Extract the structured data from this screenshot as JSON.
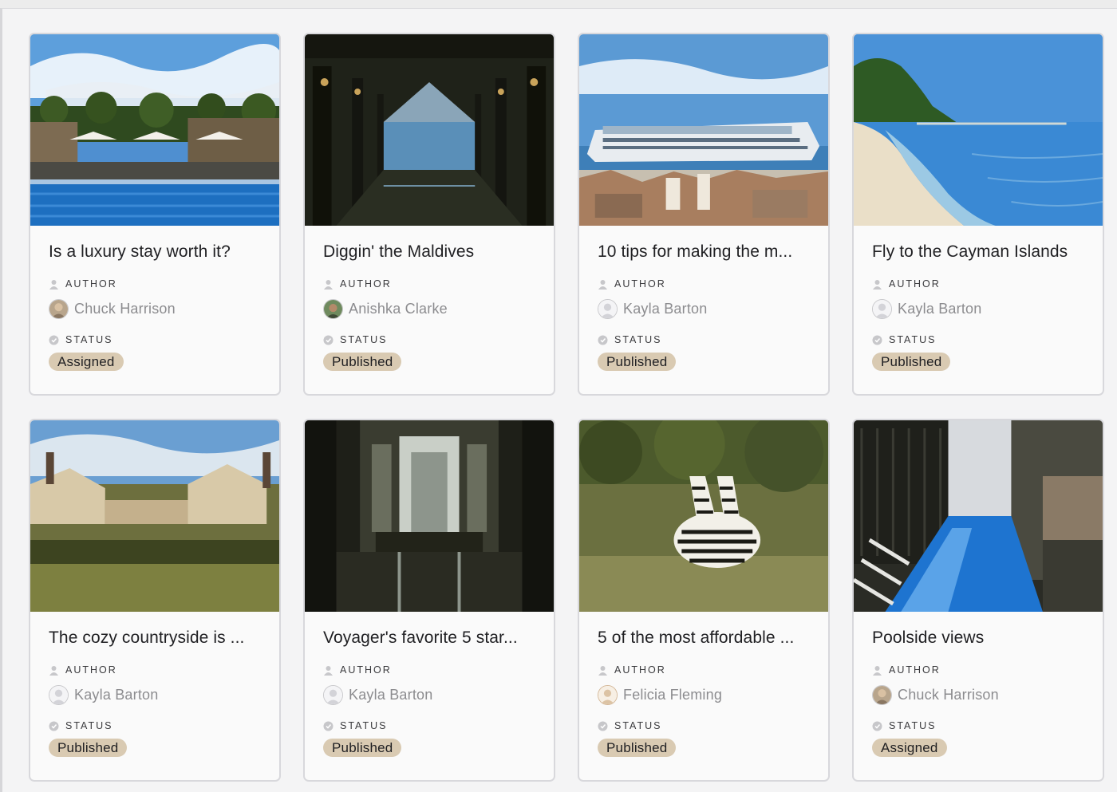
{
  "fields": {
    "author_label": "AUTHOR",
    "status_label": "STATUS"
  },
  "colors": {
    "pill_bg": "#d9cab2",
    "author_text": "#8c8c8f",
    "card_border": "#d8d8dc"
  },
  "cards": [
    {
      "title": "Is a luxury stay worth it?",
      "author": "Chuck Harrison",
      "avatar": "photo-avatar",
      "status": "Assigned",
      "cover": "resort-pool-image"
    },
    {
      "title": "Diggin' the Maldives",
      "author": "Anishka Clarke",
      "avatar": "photo-avatar",
      "status": "Published",
      "cover": "overwater-pier-image"
    },
    {
      "title": "10 tips for making the m...",
      "author": "Kayla Barton",
      "avatar": "default-user-avatar",
      "status": "Published",
      "cover": "cruise-ship-image"
    },
    {
      "title": "Fly to the Cayman Islands",
      "author": "Kayla Barton",
      "avatar": "default-user-avatar",
      "status": "Published",
      "cover": "beach-image"
    },
    {
      "title": "The cozy countryside is ...",
      "author": "Kayla Barton",
      "avatar": "default-user-avatar",
      "status": "Published",
      "cover": "country-house-image"
    },
    {
      "title": "Voyager's favorite 5 star...",
      "author": "Kayla Barton",
      "avatar": "default-user-avatar",
      "status": "Published",
      "cover": "hotel-lobby-image"
    },
    {
      "title": "5 of the most affordable ...",
      "author": "Felicia Fleming",
      "avatar": "default-user-avatar",
      "status": "Published",
      "cover": "zebras-image"
    },
    {
      "title": "Poolside views",
      "author": "Chuck Harrison",
      "avatar": "photo-avatar",
      "status": "Assigned",
      "cover": "rooftop-pool-image"
    }
  ]
}
